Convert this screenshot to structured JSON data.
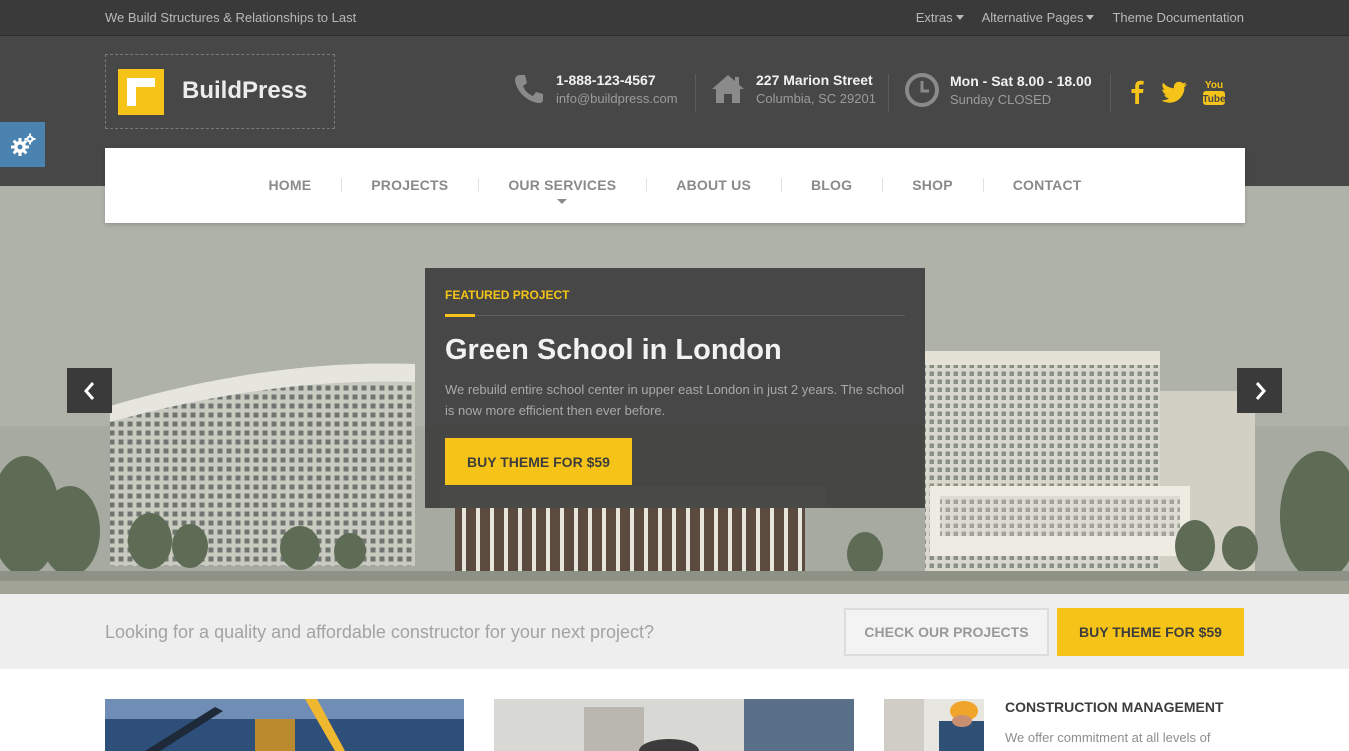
{
  "topbar": {
    "tagline": "We Build Structures & Relationships to Last",
    "links": [
      "Extras",
      "Alternative Pages",
      "Theme Documentation"
    ]
  },
  "header": {
    "logo_text": "BuildPress",
    "phone": {
      "line1": "1-888-123-4567",
      "line2": "info@buildpress.com",
      "icon": "phone-icon"
    },
    "address": {
      "line1": "227 Marion Street",
      "line2": "Columbia, SC 29201",
      "icon": "home-icon"
    },
    "hours": {
      "line1": "Mon - Sat 8.00 - 18.00",
      "line2": "Sunday CLOSED",
      "icon": "clock-icon"
    },
    "social": [
      "facebook-icon",
      "twitter-icon",
      "youtube-icon"
    ],
    "social_yt_text": [
      "You",
      "Tube"
    ]
  },
  "nav": {
    "items": [
      "HOME",
      "PROJECTS",
      "OUR SERVICES",
      "ABOUT US",
      "BLOG",
      "SHOP",
      "CONTACT"
    ]
  },
  "hero": {
    "tag": "FEATURED PROJECT",
    "title": "Green School in London",
    "text": "We rebuild entire school center in upper east London in just 2 years. The school is now more efficient then ever before.",
    "button": "BUY THEME FOR $59"
  },
  "cta": {
    "text": "Looking for a quality and affordable constructor for your next project?",
    "secondary_button": "CHECK OUR PROJECTS",
    "primary_button": "BUY THEME FOR $59"
  },
  "services": {
    "title": "CONSTRUCTION MANAGEMENT",
    "text": "We offer commitment at all levels of building management for"
  },
  "colors": {
    "accent": "#f6c418",
    "dark": "#474747",
    "settings": "#4a83b0"
  }
}
